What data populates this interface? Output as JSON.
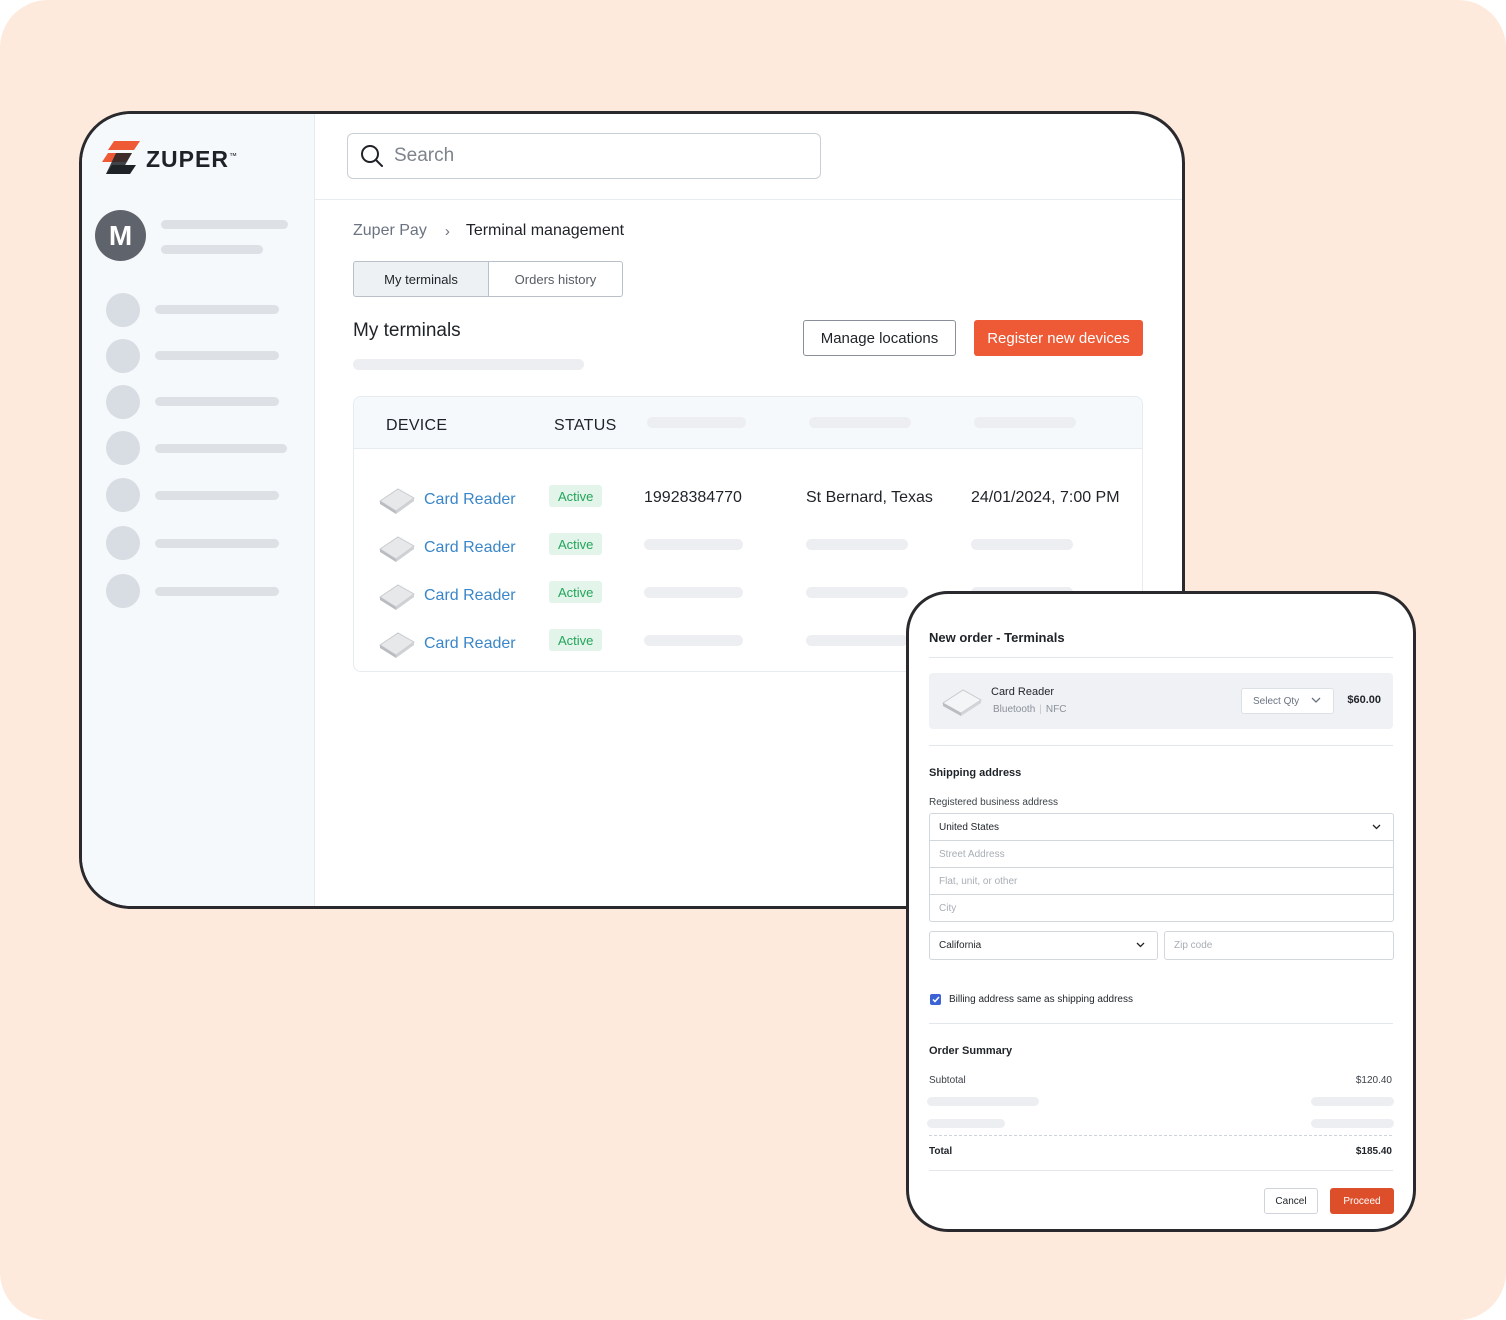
{
  "brand": {
    "name": "ZUPER",
    "trademark": "™",
    "accent": "#ee5a36"
  },
  "sidebar": {
    "avatar_initial": "M"
  },
  "search": {
    "placeholder": "Search"
  },
  "breadcrumb": {
    "root": "Zuper Pay",
    "current": "Terminal management"
  },
  "tabs": [
    {
      "label": "My terminals",
      "active": true
    },
    {
      "label": "Orders history",
      "active": false
    }
  ],
  "section": {
    "title": "My terminals",
    "manage_label": "Manage locations",
    "register_label": "Register new devices"
  },
  "table": {
    "columns": [
      "DEVICE",
      "STATUS"
    ],
    "rows": [
      {
        "device": "Card Reader",
        "status": "Active",
        "serial": "19928384770",
        "location": "St Bernard, Texas",
        "date": "24/01/2024, 7:00 PM"
      },
      {
        "device": "Card Reader",
        "status": "Active"
      },
      {
        "device": "Card Reader",
        "status": "Active"
      },
      {
        "device": "Card Reader",
        "status": "Active"
      }
    ]
  },
  "order_panel": {
    "title": "New order - Terminals",
    "product": {
      "name": "Card Reader",
      "feature_1": "Bluetooth",
      "feature_2": "NFC",
      "qty_placeholder": "Select Qty",
      "price": "$60.00"
    },
    "shipping": {
      "heading": "Shipping address",
      "label": "Registered business address",
      "country": "United States",
      "street_placeholder": "Street Address",
      "flat_placeholder": "Flat, unit, or other",
      "city_placeholder": "City",
      "state": "California",
      "zip_placeholder": "Zip code"
    },
    "billing_same_label": "Billing address same as shipping address",
    "billing_same_checked": true,
    "summary": {
      "heading": "Order Summary",
      "subtotal_label": "Subtotal",
      "subtotal_value": "$120.40",
      "total_label": "Total",
      "total_value": "$185.40"
    },
    "cancel_label": "Cancel",
    "proceed_label": "Proceed"
  }
}
